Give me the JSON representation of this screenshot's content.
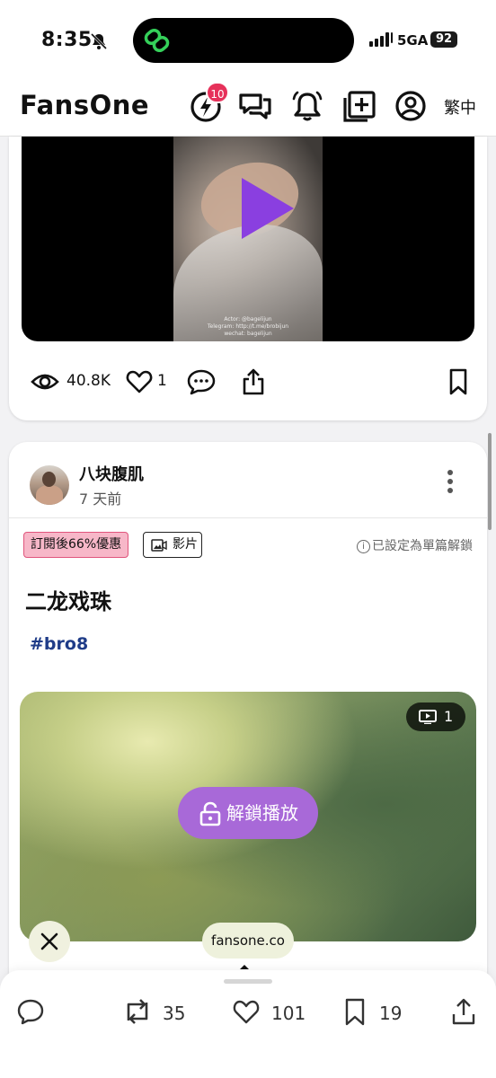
{
  "status_bar": {
    "time": "8:35",
    "network": "5GA",
    "battery": "92"
  },
  "header": {
    "logo": "FansOne",
    "notification_count": "10",
    "language": "繁中"
  },
  "post1": {
    "video_caption_lines": [
      "Actor: @bagelijun",
      "Telegram: http://t.me/brobijun",
      "wechat: bagelijun"
    ],
    "views": "40.8K",
    "likes": "1",
    "accent_color": "#8a3fe0"
  },
  "post2": {
    "author": "八块腹肌",
    "time_ago": "7 天前",
    "promo_badge": "訂閱後66%優惠",
    "media_tag": "影片",
    "unlock_note": "已設定為單篇解鎖",
    "title": "二龙戏珠",
    "hashtag": "#bro8",
    "media_count": "1",
    "unlock_button": "解鎖播放"
  },
  "browser": {
    "url": "fansone.co"
  },
  "bottom_bar": {
    "retweets": "35",
    "likes": "101",
    "bookmarks": "19"
  }
}
